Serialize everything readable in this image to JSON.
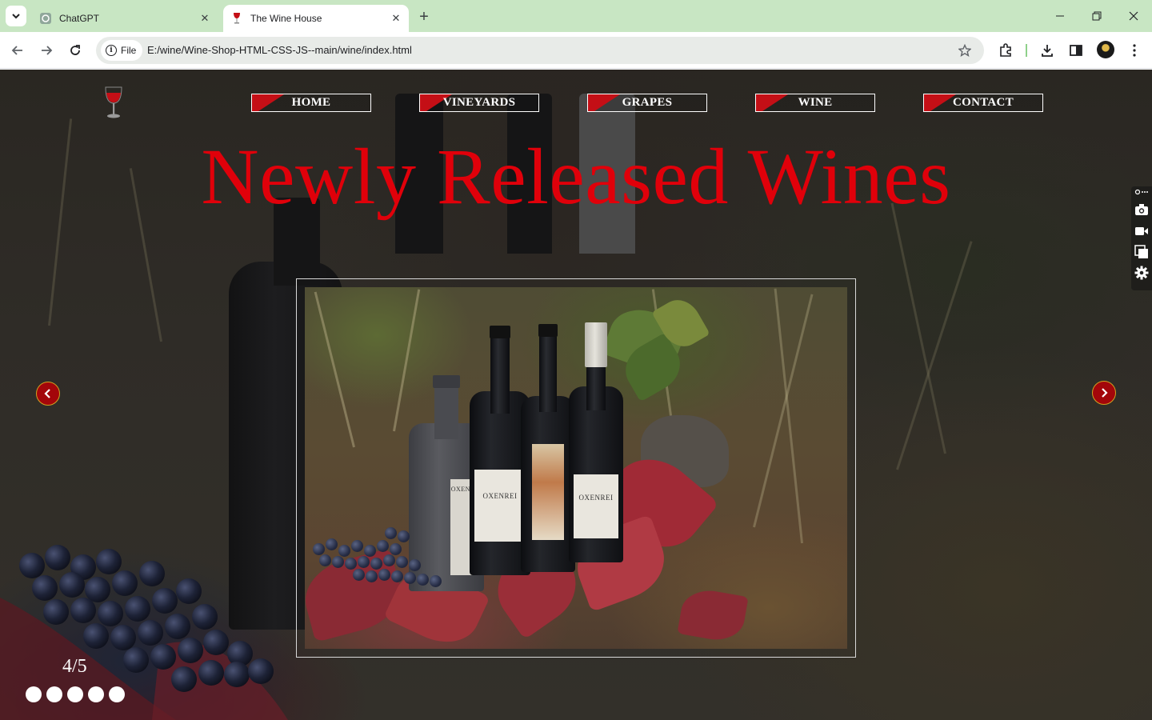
{
  "browser": {
    "tabs": [
      {
        "title": "ChatGPT",
        "active": false
      },
      {
        "title": "The Wine House",
        "active": true
      }
    ],
    "address": {
      "chip_label": "File",
      "url": "E:/wine/Wine-Shop-HTML-CSS-JS--main/wine/index.html"
    },
    "icons": [
      "tab-search-icon",
      "back-icon",
      "forward-icon",
      "reload-icon",
      "info-icon",
      "star-icon",
      "extensions-icon",
      "download-icon",
      "side-panel-icon",
      "menu-icon",
      "minimize-icon",
      "restore-icon",
      "close-icon"
    ]
  },
  "site": {
    "logo_icon": "wine-glass-icon",
    "nav": [
      {
        "label": "HOME"
      },
      {
        "label": "VINEYARDS"
      },
      {
        "label": "GRAPES"
      },
      {
        "label": "WINE"
      },
      {
        "label": "CONTACT"
      }
    ],
    "headline": "Newly Released Wines",
    "slider": {
      "counter": "4/5",
      "current": 4,
      "total": 5,
      "prev_icon": "chevron-left-icon",
      "next_icon": "chevron-right-icon",
      "photo_brand": "OXENREI"
    },
    "side_tools": [
      "link-icon",
      "camera-icon",
      "video-icon",
      "copy-icon",
      "gear-icon"
    ]
  },
  "colors": {
    "headline": "#e0000a",
    "nav_accent": "#c40f16",
    "chrome_titlebar": "#c8e6c3",
    "arrow_fill": "#a3060a"
  }
}
